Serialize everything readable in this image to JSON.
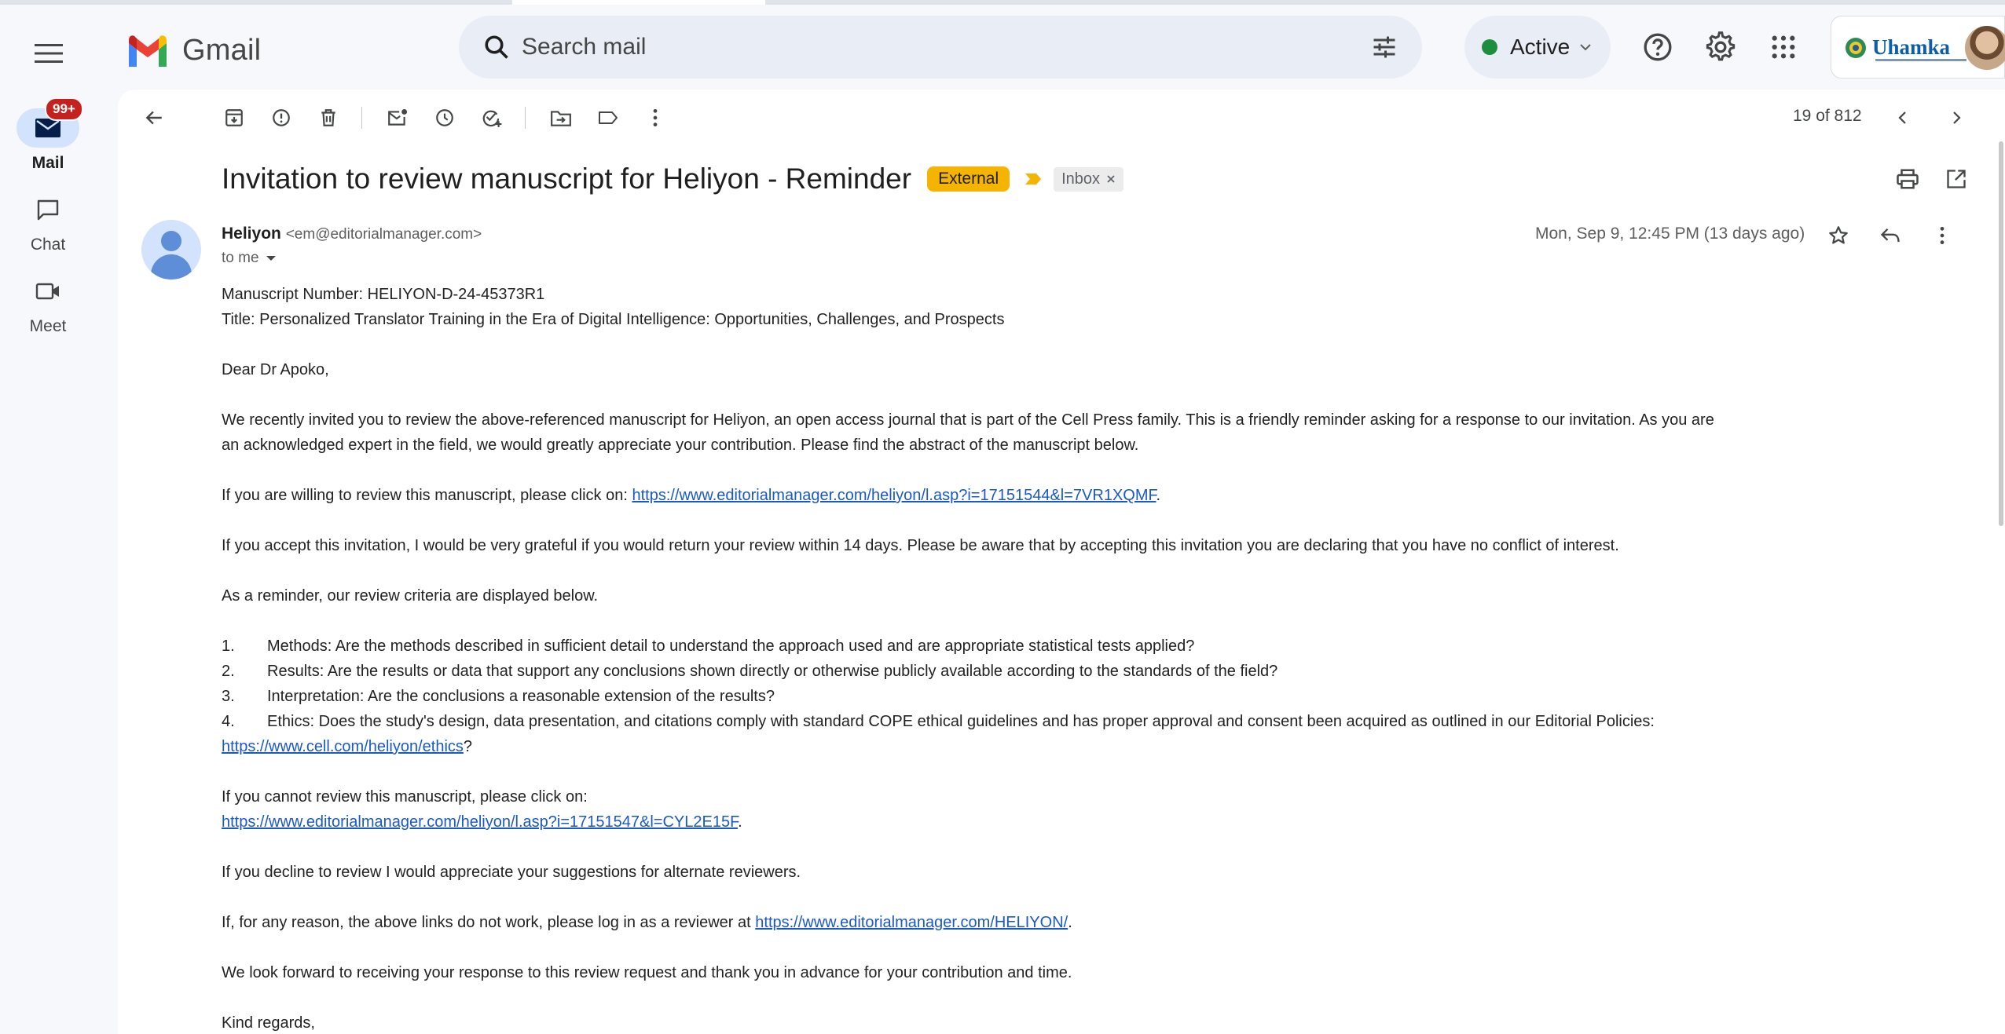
{
  "app": {
    "name": "Gmail",
    "search_placeholder": "Search mail",
    "status": "Active",
    "org_name": "Uhamka"
  },
  "nav": [
    {
      "label": "Mail",
      "badge": "99+"
    },
    {
      "label": "Chat"
    },
    {
      "label": "Meet"
    }
  ],
  "toolbar": {
    "count": "19 of 812"
  },
  "message": {
    "subject": "Invitation to review manuscript for Heliyon - Reminder",
    "labels": {
      "external": "External",
      "inbox": "Inbox"
    },
    "sender_name": "Heliyon",
    "sender_email": "<em@editorialmanager.com>",
    "to": "to me",
    "date": "Mon, Sep 9, 12:45 PM (13 days ago)",
    "body": {
      "manuscript_number": "Manuscript Number: HELIYON-D-24-45373R1",
      "title": "Title: Personalized Translator Training in the Era of Digital Intelligence: Opportunities, Challenges, and Prospects",
      "greeting": "Dear Dr Apoko,",
      "para1_line1": "We recently invited you to review the above-referenced manuscript for Heliyon, an open access journal that is part of the Cell Press family. This is a friendly reminder asking for a response to our invitation. As you are",
      "para1_line2": "an acknowledged expert in the field, we would greatly appreciate your contribution. Please find the abstract of the manuscript below.",
      "accept_prefix": "If you are willing to review this manuscript, please click on: ",
      "accept_link": "https://www.editorialmanager.com/heliyon/l.asp?i=17151544&l=7VR1XQMF",
      "accept_suffix": ".",
      "para_accept": "If you accept this invitation, I would be very grateful if you would return your review within 14 days. Please be aware that by accepting this invitation you are declaring that you have no conflict of interest.",
      "criteria_intro": "As a reminder, our review criteria are displayed below.",
      "criteria": [
        {
          "num": "1.",
          "text": "Methods: Are the methods described in sufficient detail to understand the approach used and are appropriate statistical tests applied?"
        },
        {
          "num": "2.",
          "text": "Results: Are the results or data that support any conclusions shown directly or otherwise publicly available according to the standards of the field?"
        },
        {
          "num": "3.",
          "text": "Interpretation:  Are the conclusions a reasonable extension of the results?"
        },
        {
          "num": "4.",
          "text": "Ethics: Does the study's design, data presentation, and citations comply with standard COPE ethical guidelines and has proper approval and consent been acquired as outlined in our Editorial Policies:"
        }
      ],
      "ethics_link": "https://www.cell.com/heliyon/ethics",
      "ethics_suffix": "?",
      "decline_prefix": "If you cannot review this manuscript, please click on:",
      "decline_link": "https://www.editorialmanager.com/heliyon/l.asp?i=17151547&l=CYL2E15F",
      "decline_suffix": ".",
      "alternates": "If you decline to review I would appreciate your suggestions for alternate reviewers.",
      "login_prefix": "If, for any reason, the above links do not work, please log in as a reviewer at ",
      "login_link": "https://www.editorialmanager.com/HELIYON/",
      "login_suffix": ".",
      "closing": "We look forward to receiving your response to this review request and thank you in advance for your contribution and time.",
      "signoff": "Kind regards,"
    }
  }
}
